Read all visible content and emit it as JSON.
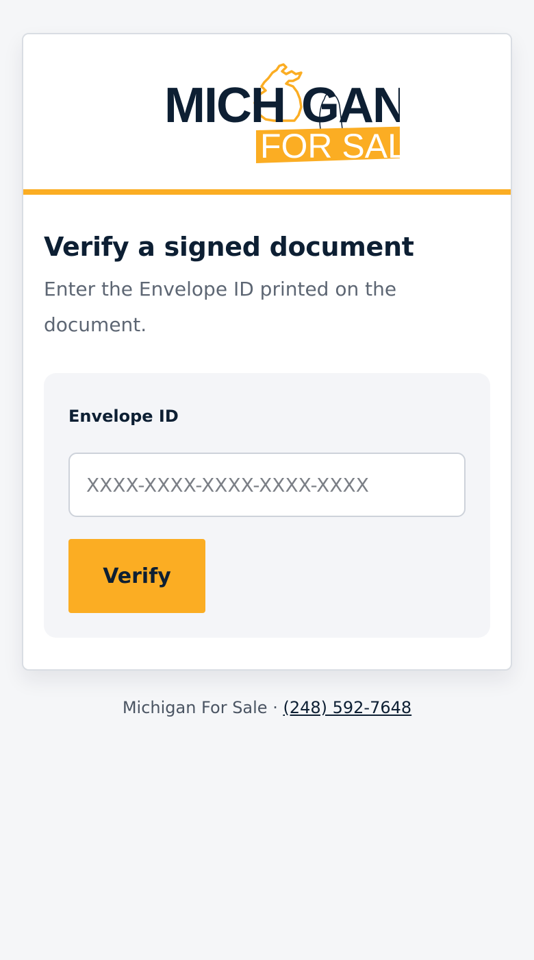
{
  "brand": {
    "logo_word_top": "MICHIGAN",
    "logo_word_bottom": "FOR SALE",
    "colors": {
      "navy": "#0d1f33",
      "gold": "#fbad23"
    }
  },
  "main": {
    "title": "Verify a signed document",
    "subtitle": "Enter the Envelope ID printed on the document."
  },
  "form": {
    "label": "Envelope ID",
    "input_value": "",
    "input_placeholder": "XXXX-XXXX-XXXX-XXXX-XXXX",
    "button_label": "Verify"
  },
  "footer": {
    "company": "Michigan For Sale",
    "separator": " · ",
    "phone": "(248) 592-7648"
  }
}
